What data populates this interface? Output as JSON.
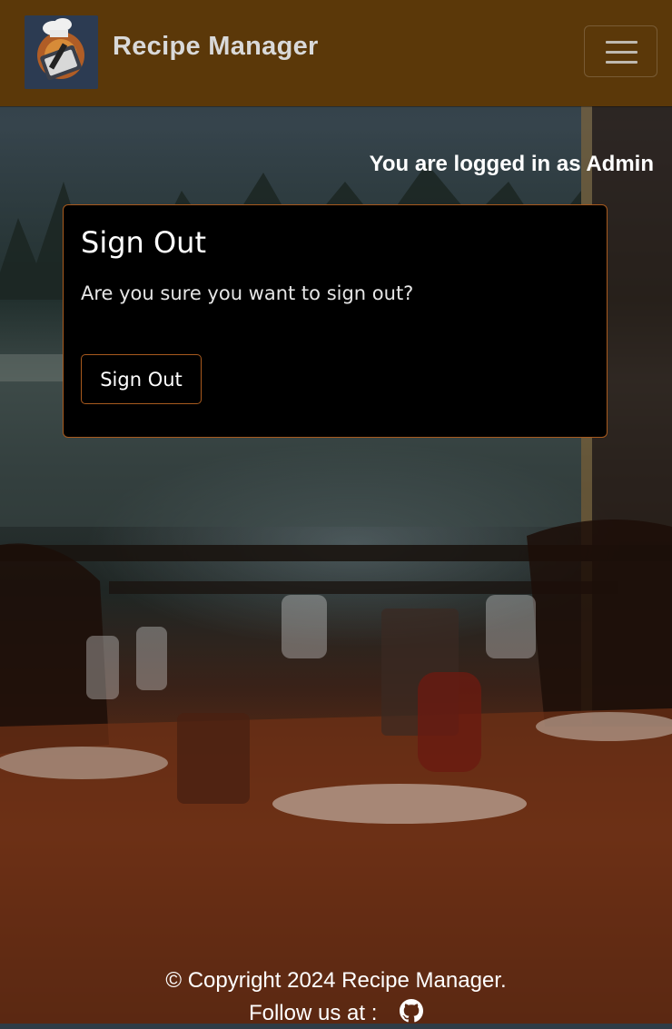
{
  "navbar": {
    "brand": "Recipe Manager",
    "logo_icon": "chef-logo-icon",
    "menu_icon": "hamburger-menu-icon",
    "background_color": "#5b3809"
  },
  "status": {
    "logged_in_text": "You are logged in as Admin"
  },
  "signout_card": {
    "title": "Sign Out",
    "message": "Are you sure you want to sign out?",
    "button_label": "Sign Out",
    "border_color": "#a85a1e"
  },
  "footer": {
    "copyright": "© Copyright 2024 Recipe Manager.",
    "follow_text": "Follow us at :",
    "social_icon": "github-icon"
  }
}
